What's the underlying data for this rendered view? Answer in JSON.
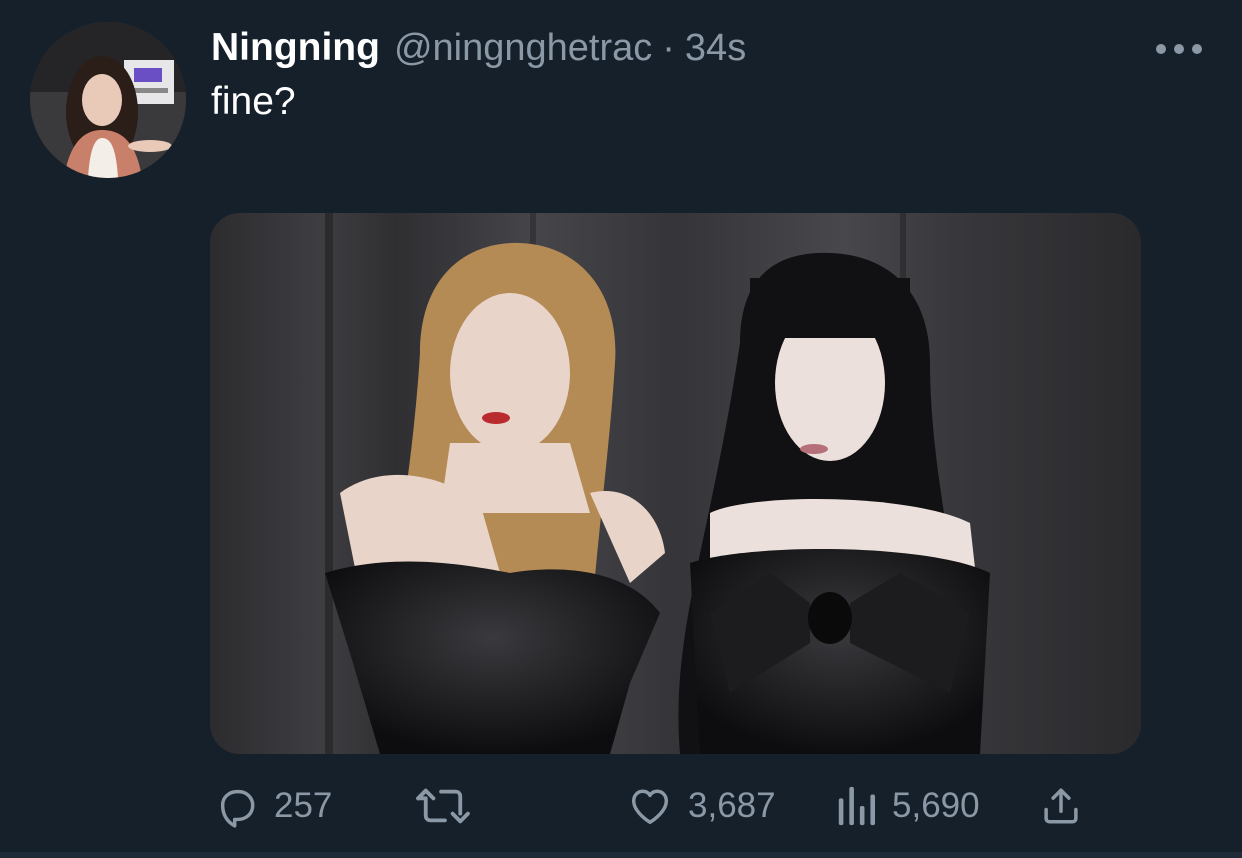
{
  "tweet": {
    "display_name": "Ningning",
    "handle": "@ningnghetrac",
    "separator": "·",
    "time": "34s",
    "text": "fine?",
    "avatar_icon": "user-avatar",
    "media_description_icon": "photo"
  },
  "actions": {
    "reply_count": "257",
    "retweet_count": "",
    "like_count": "3,687",
    "view_count": "5,690"
  },
  "colors": {
    "background": "#15202b",
    "primary_text": "#ffffff",
    "secondary_text": "#8b98a5"
  }
}
